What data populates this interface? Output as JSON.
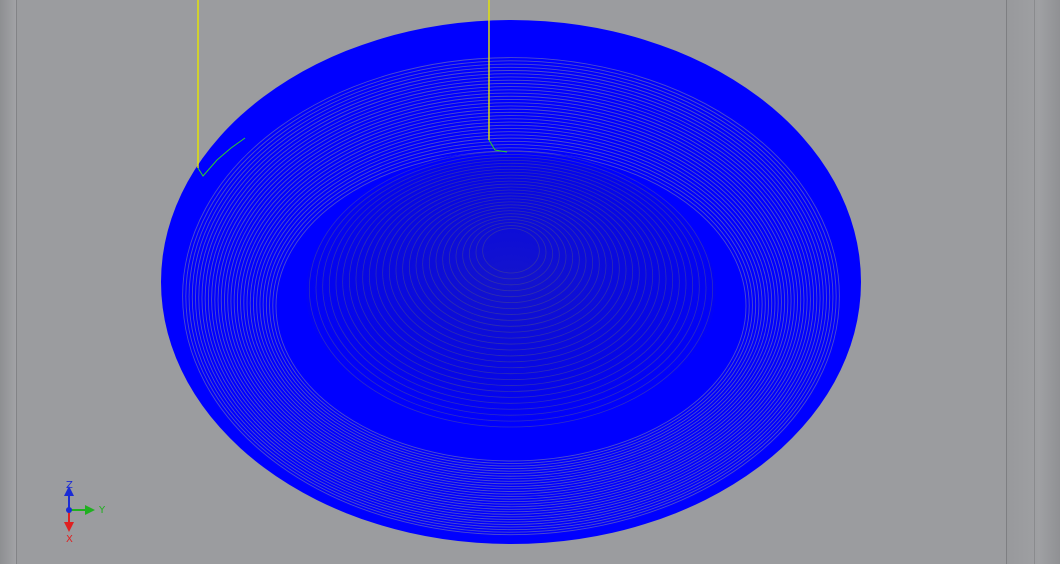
{
  "viewport": {
    "background": "#9b9c9f",
    "toolpath_color": "#0000ff",
    "toolpath_outline_color": "#1010e0",
    "rapid_move_color": "#e6e600",
    "entry_move_color": "#2ecc2e"
  },
  "axes": {
    "z_label": "Z",
    "y_label": "Y",
    "x_label": "X",
    "z_color": "#1a2bd6",
    "y_color": "#20b020",
    "x_color": "#e02020"
  },
  "icons": {
    "axis_triad": "xyz-axis-triad-icon"
  }
}
